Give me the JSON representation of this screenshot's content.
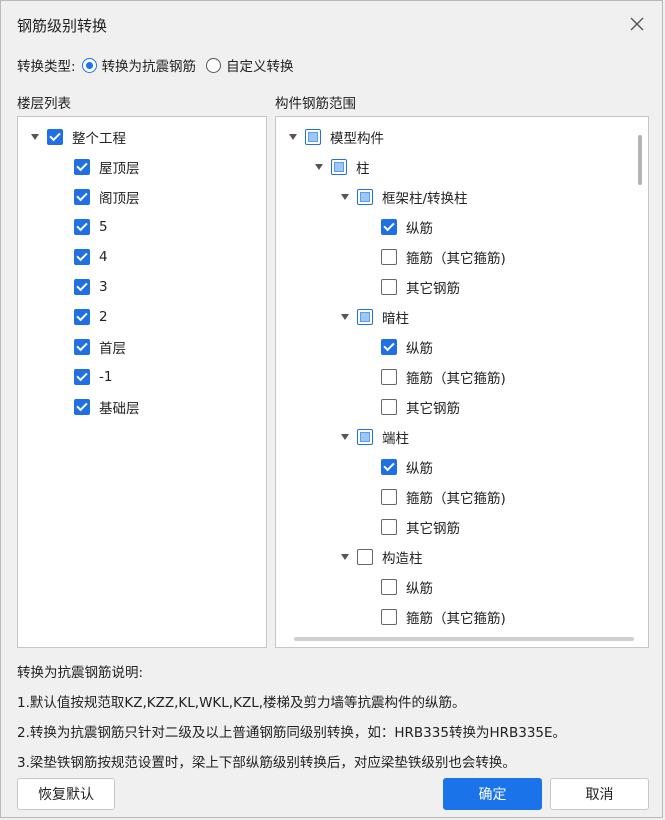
{
  "dialog": {
    "title": "钢筋级别转换"
  },
  "conversion_type": {
    "label": "转换类型:",
    "options": [
      {
        "label": "转换为抗震钢筋",
        "selected": true
      },
      {
        "label": "自定义转换",
        "selected": false
      }
    ]
  },
  "floor_list": {
    "heading": "楼层列表",
    "root": {
      "label": "整个工程",
      "checked": true
    },
    "items": [
      {
        "label": "屋顶层",
        "checked": true
      },
      {
        "label": "阁顶层",
        "checked": true
      },
      {
        "label": "5",
        "checked": true
      },
      {
        "label": "4",
        "checked": true
      },
      {
        "label": "3",
        "checked": true
      },
      {
        "label": "2",
        "checked": true
      },
      {
        "label": "首层",
        "checked": true
      },
      {
        "label": "-1",
        "checked": true
      },
      {
        "label": "基础层",
        "checked": true
      }
    ]
  },
  "component_range": {
    "heading": "构件钢筋范围",
    "rows": [
      {
        "label": "模型构件",
        "level": 0,
        "expand": true,
        "state": "partial"
      },
      {
        "label": "柱",
        "level": 1,
        "expand": true,
        "state": "partial"
      },
      {
        "label": "框架柱/转换柱",
        "level": 2,
        "expand": true,
        "state": "partial"
      },
      {
        "label": "纵筋",
        "level": 3,
        "expand": false,
        "state": "checked"
      },
      {
        "label": "箍筋（其它箍筋)",
        "level": 3,
        "expand": false,
        "state": "unchecked"
      },
      {
        "label": "其它钢筋",
        "level": 3,
        "expand": false,
        "state": "unchecked"
      },
      {
        "label": "暗柱",
        "level": 2,
        "expand": true,
        "state": "partial"
      },
      {
        "label": "纵筋",
        "level": 3,
        "expand": false,
        "state": "checked"
      },
      {
        "label": "箍筋（其它箍筋)",
        "level": 3,
        "expand": false,
        "state": "unchecked"
      },
      {
        "label": "其它钢筋",
        "level": 3,
        "expand": false,
        "state": "unchecked"
      },
      {
        "label": "端柱",
        "level": 2,
        "expand": true,
        "state": "partial"
      },
      {
        "label": "纵筋",
        "level": 3,
        "expand": false,
        "state": "checked"
      },
      {
        "label": "箍筋（其它箍筋)",
        "level": 3,
        "expand": false,
        "state": "unchecked"
      },
      {
        "label": "其它钢筋",
        "level": 3,
        "expand": false,
        "state": "unchecked"
      },
      {
        "label": "构造柱",
        "level": 2,
        "expand": true,
        "state": "unchecked"
      },
      {
        "label": "纵筋",
        "level": 3,
        "expand": false,
        "state": "unchecked"
      },
      {
        "label": "箍筋（其它箍筋)",
        "level": 3,
        "expand": false,
        "state": "unchecked"
      }
    ]
  },
  "notes": {
    "heading": "转换为抗震钢筋说明:",
    "lines": [
      "1.默认值按规范取KZ,KZZ,KL,WKL,KZL,楼梯及剪力墙等抗震构件的纵筋。",
      "2.转换为抗震钢筋只针对二级及以上普通钢筋同级别转换，如：HRB335转换为HRB335E。",
      "3.梁垫铁钢筋按规范设置时，梁上下部纵筋级别转换后，对应梁垫铁级别也会转换。"
    ]
  },
  "buttons": {
    "restore": "恢复默认",
    "ok": "确定",
    "cancel": "取消"
  },
  "colors": {
    "accent": "#1a73e8"
  }
}
